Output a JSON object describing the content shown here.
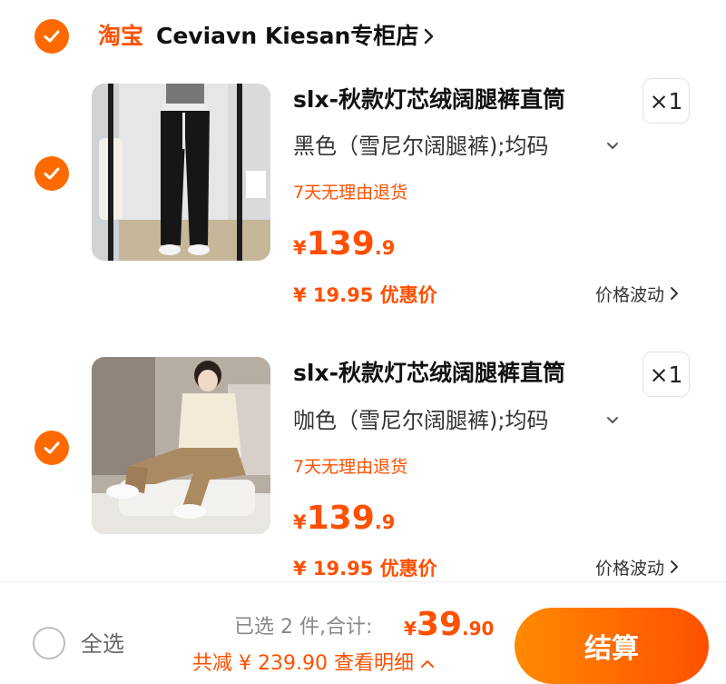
{
  "shop": {
    "brand": "淘宝",
    "name": "Ceviavn Kiesan专柜店"
  },
  "items": [
    {
      "title": "slx-秋款灯芯绒阔腿裤直筒",
      "quantity": "×1",
      "sku": "黑色（雪尼尔阔腿裤);均码",
      "return_policy": "7天无理由退货",
      "price_currency": "¥",
      "price_integer": "139",
      "price_decimal": ".9",
      "promo_price": "¥ 19.95 优惠价",
      "fluctuation": "价格波动",
      "colors": {
        "bg": "#dfe3e6",
        "garment": "#1e1e1e"
      }
    },
    {
      "title": "slx-秋款灯芯绒阔腿裤直筒",
      "quantity": "×1",
      "sku": "咖色（雪尼尔阔腿裤);均码",
      "return_policy": "7天无理由退货",
      "price_currency": "¥",
      "price_integer": "139",
      "price_decimal": ".9",
      "promo_price": "¥ 19.95 优惠价",
      "fluctuation": "价格波动",
      "colors": {
        "bg": "#c9bfb3",
        "garment": "#a98a63"
      }
    }
  ],
  "footer": {
    "select_all": "全选",
    "selected_summary": "已选 2 件,合计:",
    "total_currency": "¥",
    "total_integer": "39",
    "total_decimal": ".90",
    "saving": "共减 ¥ 239.90",
    "detail_link": "查看明细",
    "checkout": "结算"
  },
  "theme": {
    "accent": "#ff5000",
    "check": "#ff6a00"
  }
}
